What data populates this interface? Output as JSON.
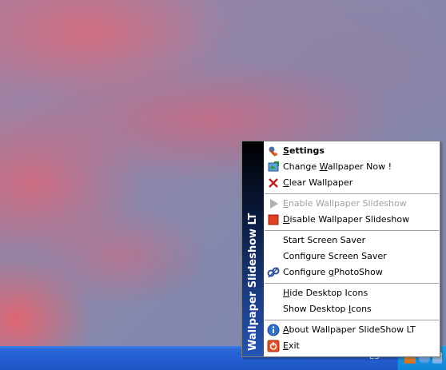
{
  "menu": {
    "sidebar_title": "Wallpaper Slideshow LT",
    "items": [
      {
        "pre": "",
        "ul": "S",
        "post": "ettings"
      },
      {
        "pre": "Change ",
        "ul": "W",
        "post": "allpaper Now !"
      },
      {
        "pre": "",
        "ul": "C",
        "post": "lear Wallpaper"
      },
      {
        "pre": "",
        "ul": "E",
        "post": "nable Wallpaper Slideshow"
      },
      {
        "pre": "",
        "ul": "D",
        "post": "isable Wallpaper Slideshow"
      },
      {
        "pre": "Start Screen Saver",
        "ul": "",
        "post": ""
      },
      {
        "pre": "Configure Screen Saver",
        "ul": "",
        "post": ""
      },
      {
        "pre": "Configure ",
        "ul": "g",
        "post": "PhotoShow"
      },
      {
        "pre": "",
        "ul": "H",
        "post": "ide Desktop Icons"
      },
      {
        "pre": "Show Desktop ",
        "ul": "I",
        "post": "cons"
      },
      {
        "pre": "",
        "ul": "A",
        "post": "bout Wallpaper SlideShow LT"
      },
      {
        "pre": "",
        "ul": "E",
        "post": "xit"
      }
    ]
  },
  "taskbar": {
    "language": "ES"
  },
  "colors": {
    "taskbar": "#245ed1",
    "tray": "#0d87d8",
    "disabled_text": "#a0a0a0"
  }
}
